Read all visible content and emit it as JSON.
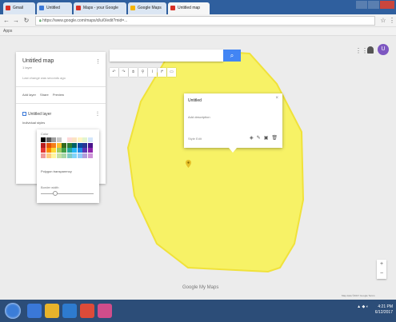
{
  "browser": {
    "tabs": [
      {
        "label": "Gmail",
        "color": "#d93025"
      },
      {
        "label": "Untitled",
        "color": "#3a78d8"
      },
      {
        "label": "Maps - your Google",
        "color": "#d93025"
      },
      {
        "label": "Google Maps",
        "color": "#f4b400"
      },
      {
        "label": "Untitled map",
        "color": "#d93025"
      }
    ],
    "url": "https://www.google.com/maps/d/u/0/edit?mid=..."
  },
  "bookmarks": "Apps",
  "panel": {
    "title": "Untitled map",
    "subtitle": "1 layer",
    "description": "Last change was seconds ago",
    "actions": [
      "Add layer",
      "Share",
      "Preview"
    ],
    "layer_name": "Untitled layer",
    "item_label": "Individual styles"
  },
  "style_popup": {
    "color_label": "Color",
    "opacity_label": "Polygon transparency",
    "border_label": "Border width",
    "swatch_colors": [
      "#000000",
      "#5a5a5a",
      "#9e9e9e",
      "#c8c8c8",
      "#ffffff",
      "#ffd9d9",
      "#fbe3c2",
      "#fff5c2",
      "#e2f5d0",
      "#d3e6fb",
      "#b71c1c",
      "#e65100",
      "#f57f17",
      "#fbc02d",
      "#33691e",
      "#2e7d32",
      "#006064",
      "#0d47a1",
      "#283593",
      "#4a148c",
      "#e53935",
      "#fb8c00",
      "#fdd835",
      "#9ccc65",
      "#43a047",
      "#26a69a",
      "#29b6f6",
      "#1e88e5",
      "#5e35b1",
      "#8e24aa",
      "#ef9a9a",
      "#ffcc80",
      "#fff59d",
      "#c5e1a5",
      "#a5d6a7",
      "#80cbc4",
      "#81d4fa",
      "#90caf9",
      "#b39ddb",
      "#ce93d8"
    ]
  },
  "info_window": {
    "title": "Untitled",
    "text": "Add description",
    "meta": "Style  Edit"
  },
  "map": {
    "polygon_fill": "#f7f266",
    "polygon_stroke": "#f0e23a",
    "google_logo": "Google My Maps",
    "footer": "Map data ©2017 Google  Terms"
  },
  "taskbar": {
    "time": "4:21 PM",
    "date": "6/12/2017"
  },
  "icons": {
    "search": "search-icon",
    "apps": "apps-grid-icon",
    "notifications": "bell-icon",
    "user_initial": "U"
  }
}
